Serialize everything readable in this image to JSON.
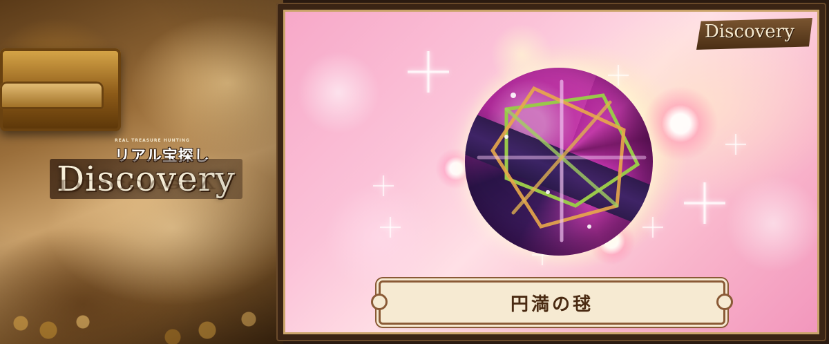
{
  "left_panel": {
    "logo_tagline": "REAL TREASURE HUNTING",
    "logo_japanese": "リアル宝探し",
    "logo_title": "Discovery",
    "logo_reflection": "Discovery"
  },
  "card": {
    "badge_label": "Discovery",
    "item_name": "円満の毬"
  },
  "colors": {
    "frame": "#3a2414",
    "plate_border": "#8a5a36",
    "plate_bg": "#f6ead2",
    "card_pink": "#f7a8c8",
    "ball_magenta": "#b02a9a",
    "ball_band": "#2a1a4a"
  }
}
